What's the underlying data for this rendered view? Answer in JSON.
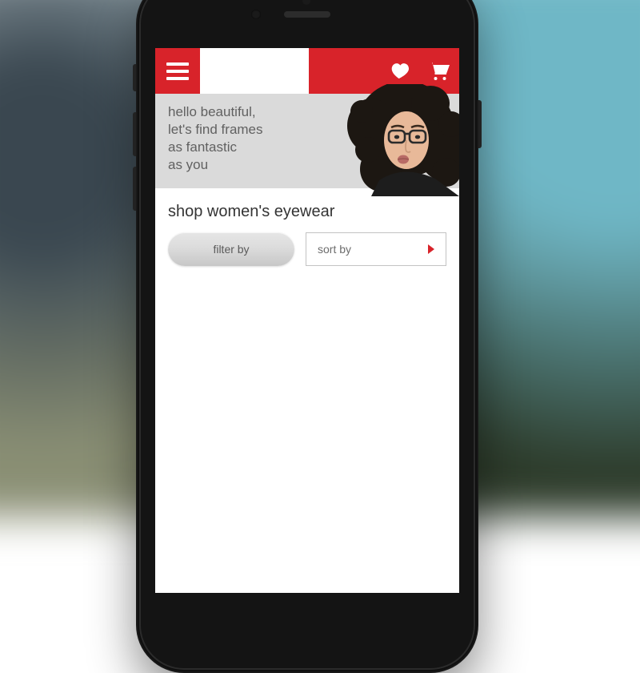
{
  "colors": {
    "brand_red": "#D8232A"
  },
  "hero": {
    "line1": "hello beautiful,",
    "line2": "let's find frames",
    "line3": "as fantastic",
    "line4": "as you"
  },
  "section": {
    "title": "shop women's eyewear"
  },
  "controls": {
    "filter_label": "filter by",
    "sort_label": "sort by"
  }
}
